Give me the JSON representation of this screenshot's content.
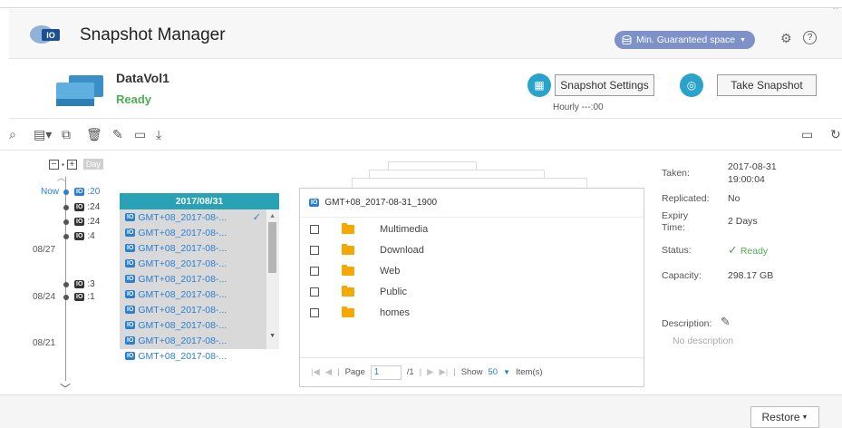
{
  "app": {
    "title": "Snapshot Manager",
    "min_guaranteed_space": "Min. Guaranteed space",
    "accent_color": "#2aa2c9"
  },
  "volume": {
    "name": "DataVol1",
    "status": "Ready",
    "snapshot_settings_label": "Snapshot Settings",
    "schedule": "Hourly ---:00",
    "take_snapshot_label": "Take Snapshot"
  },
  "timeline": {
    "day_label": "Day",
    "now_label": "Now",
    "now_snap": ":20",
    "snaps": [
      ":24",
      ":24",
      ":4",
      ":3",
      ":1"
    ],
    "dates": [
      "08/27",
      "08/24",
      "08/21"
    ]
  },
  "snapshot_list": {
    "header": "2017/08/31",
    "items": [
      "GMT+08_2017-08-...",
      "GMT+08_2017-08-...",
      "GMT+08_2017-08-...",
      "GMT+08_2017-08-...",
      "GMT+08_2017-08-...",
      "GMT+08_2017-08-...",
      "GMT+08_2017-08-...",
      "GMT+08_2017-08-...",
      "GMT+08_2017-08-...",
      "GMT+08_2017-08-..."
    ]
  },
  "browser": {
    "snapshot_name": "GMT+08_2017-08-31_1900",
    "folders": [
      "Multimedia",
      "Download",
      "Web",
      "Public",
      "homes"
    ],
    "pager": {
      "page_label": "Page",
      "page": "1",
      "total": "/1",
      "show_label": "Show",
      "show_count": "50",
      "items_label": "Item(s)"
    }
  },
  "details": {
    "taken_label": "Taken:",
    "taken_date": "2017-08-31",
    "taken_time": "19:00:04",
    "replicated_label": "Replicated:",
    "replicated": "No",
    "expiry_label_1": "Expiry",
    "expiry_label_2": "Time:",
    "expiry": "2 Days",
    "status_label": "Status:",
    "status": "Ready",
    "capacity_label": "Capacity:",
    "capacity": "298.17 GB",
    "description_label": "Description:",
    "description": "No description"
  },
  "footer": {
    "restore_label": "Restore"
  }
}
